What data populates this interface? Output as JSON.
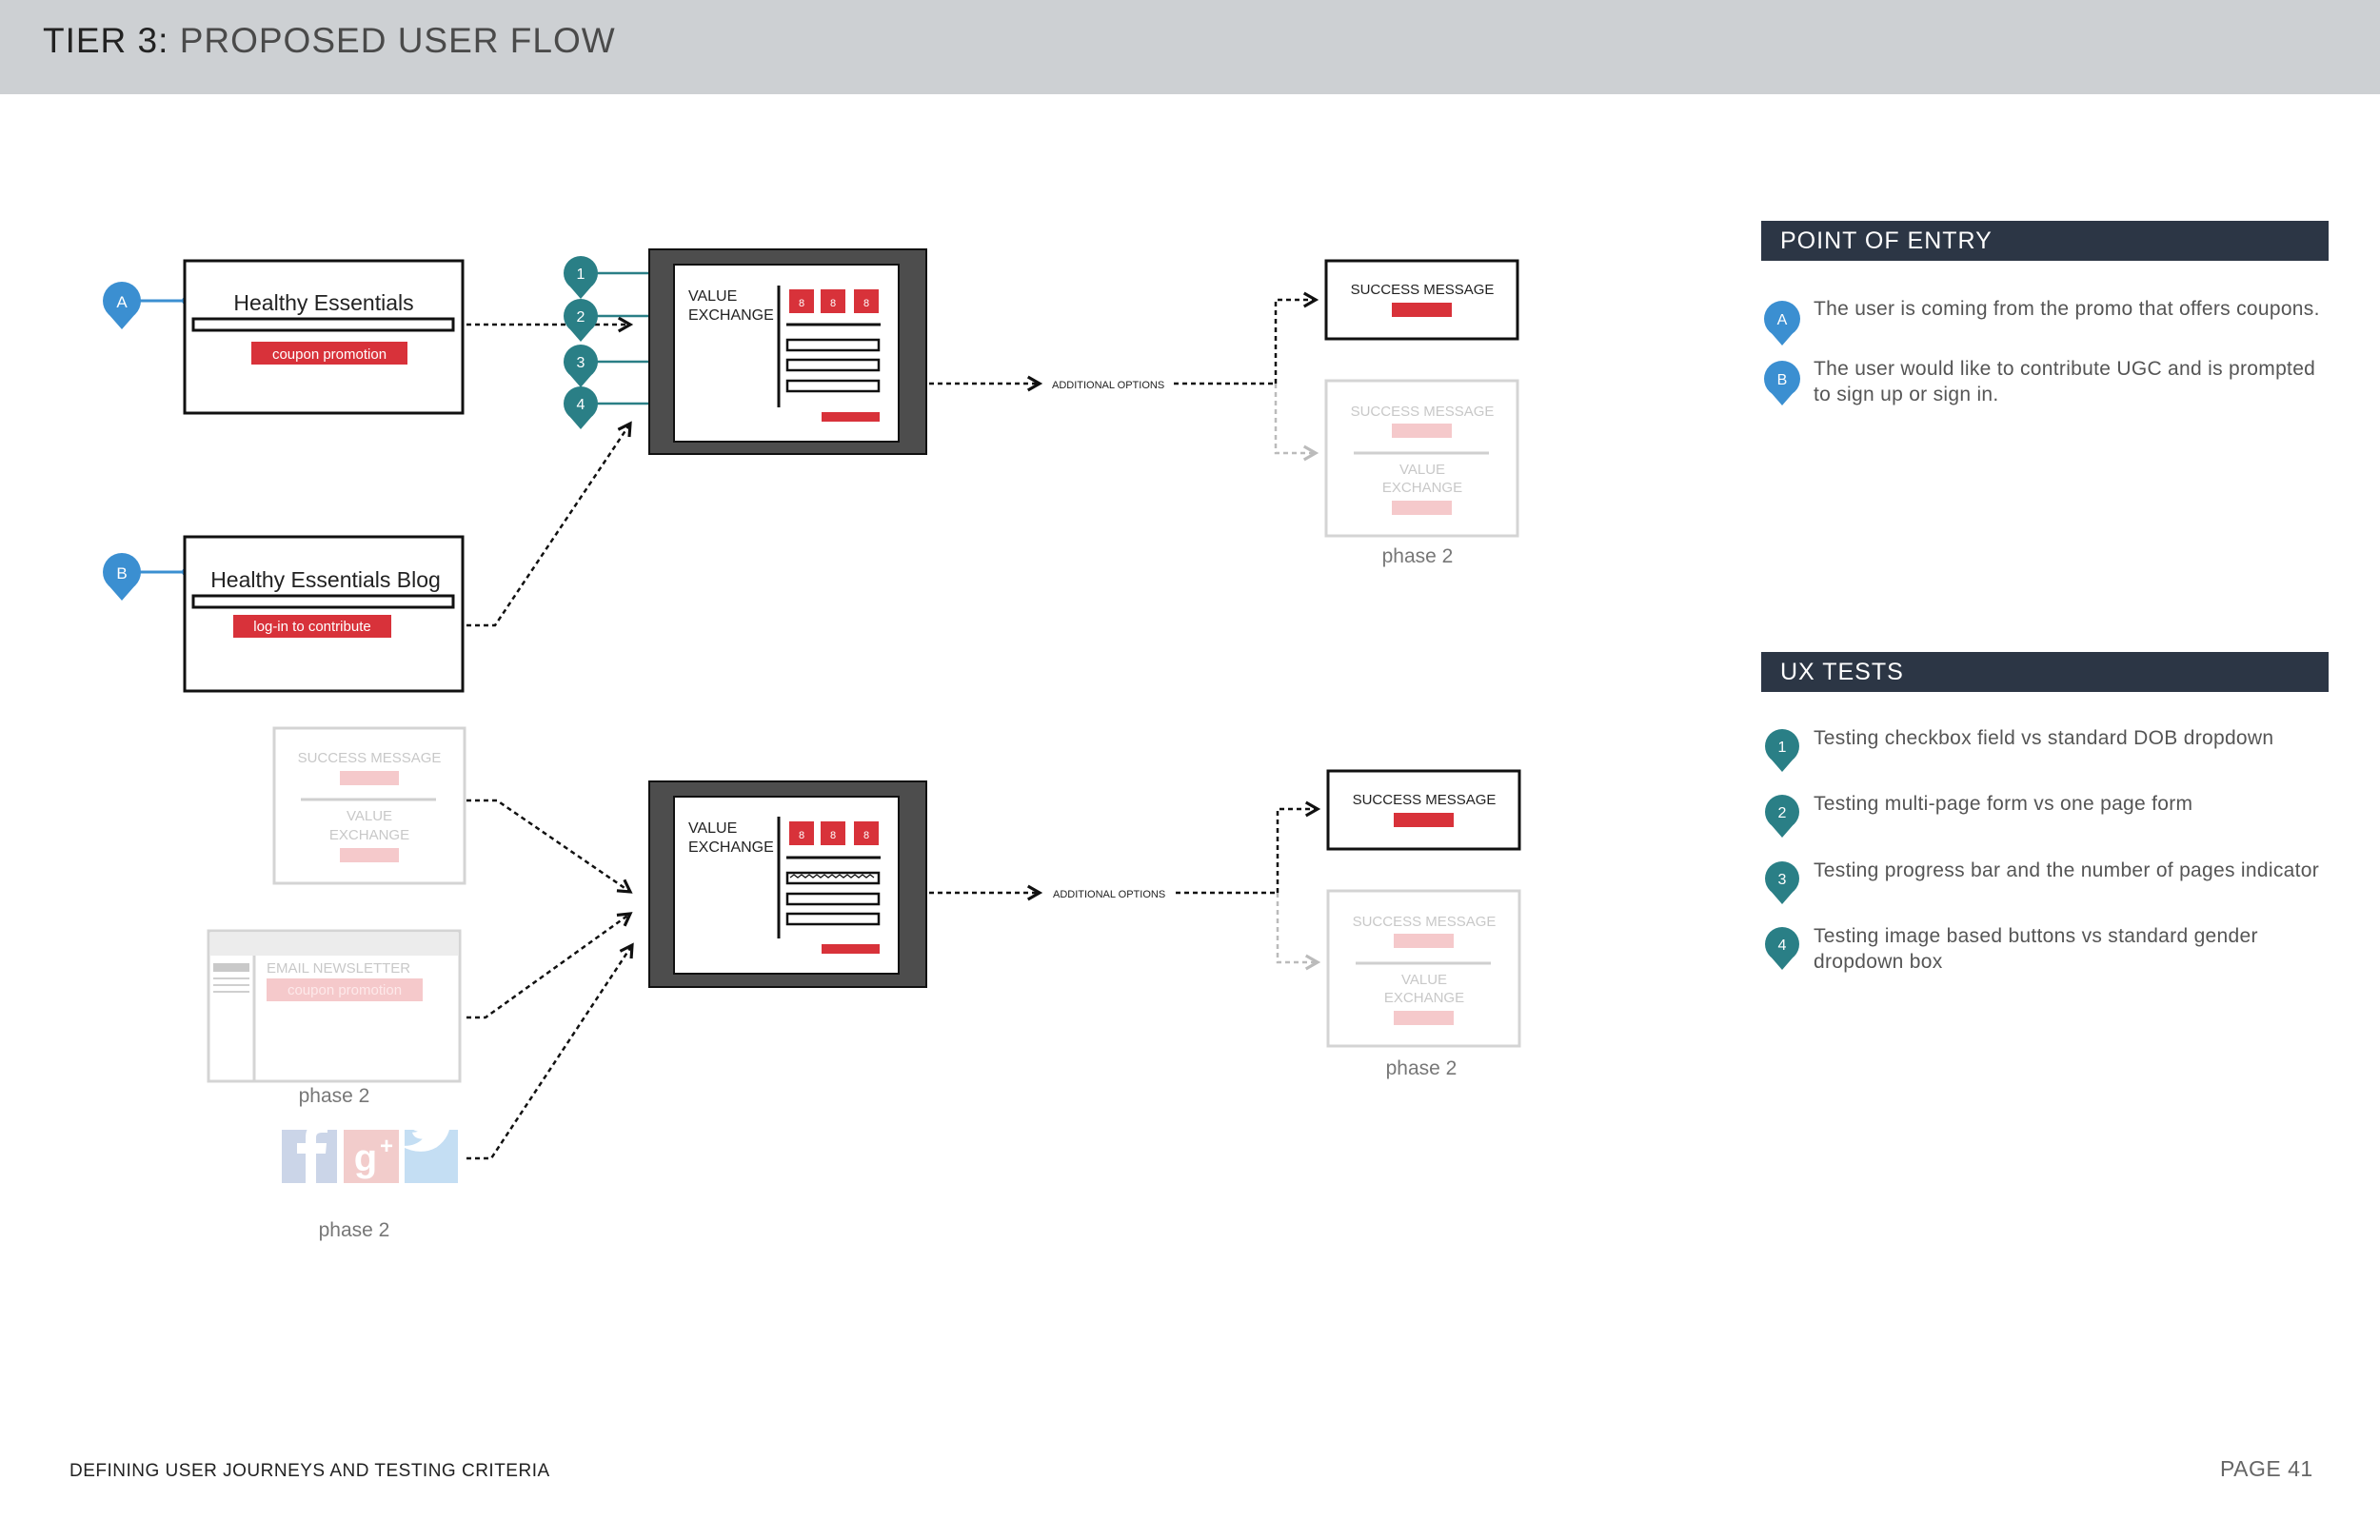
{
  "header": {
    "tier": "TIER 3:",
    "title": "PROPOSED USER FLOW"
  },
  "entry_points": {
    "a": {
      "marker": "A",
      "title": "Healthy Essentials",
      "cta": "coupon promotion"
    },
    "b": {
      "marker": "B",
      "title": "Healthy Essentials Blog",
      "cta": "log-in to contribute"
    }
  },
  "faded_sources": {
    "success_message": "SUCCESS MESSAGE",
    "value_exchange_line1": "VALUE",
    "value_exchange_line2": "EXCHANGE",
    "newsletter_title": "EMAIL NEWSLETTER",
    "newsletter_cta": "coupon promotion",
    "newsletter_phase": "phase 2",
    "social_phase": "phase 2"
  },
  "test_markers": [
    "1",
    "2",
    "3",
    "4"
  ],
  "value_exchange": {
    "line1": "VALUE",
    "line2": "EXCHANGE",
    "tile": "8"
  },
  "additional_options": "ADDITIONAL OPTIONS",
  "outcomes": {
    "success_message": "SUCCESS MESSAGE",
    "phase2_success": "SUCCESS MESSAGE",
    "phase2_value_line1": "VALUE",
    "phase2_value_line2": "EXCHANGE",
    "phase2_label": "phase 2"
  },
  "point_of_entry": {
    "title": "POINT OF ENTRY",
    "items": [
      {
        "marker": "A",
        "text": "The user is coming from the promo that offers coupons."
      },
      {
        "marker": "B",
        "text": "The user would like to contribute UGC and is prompted to sign up or sign in."
      }
    ]
  },
  "ux_tests": {
    "title": "UX TESTS",
    "items": [
      {
        "marker": "1",
        "text": "Testing checkbox field vs standard DOB dropdown"
      },
      {
        "marker": "2",
        "text": "Testing multi-page form vs one page form"
      },
      {
        "marker": "3",
        "text": "Testing progress bar and the number of pages indicator"
      },
      {
        "marker": "4",
        "text": "Testing image based buttons vs standard gender dropdown box"
      }
    ]
  },
  "footer": {
    "left": "DEFINING USER JOURNEYS AND TESTING CRITERIA",
    "right": "PAGE 41"
  },
  "colors": {
    "pin_blue": "#3b8fd1",
    "pin_teal": "#2a7f86",
    "accent_red": "#d8323a",
    "dark_frame": "#4d4d4d",
    "panel_navy": "#2c3645"
  }
}
